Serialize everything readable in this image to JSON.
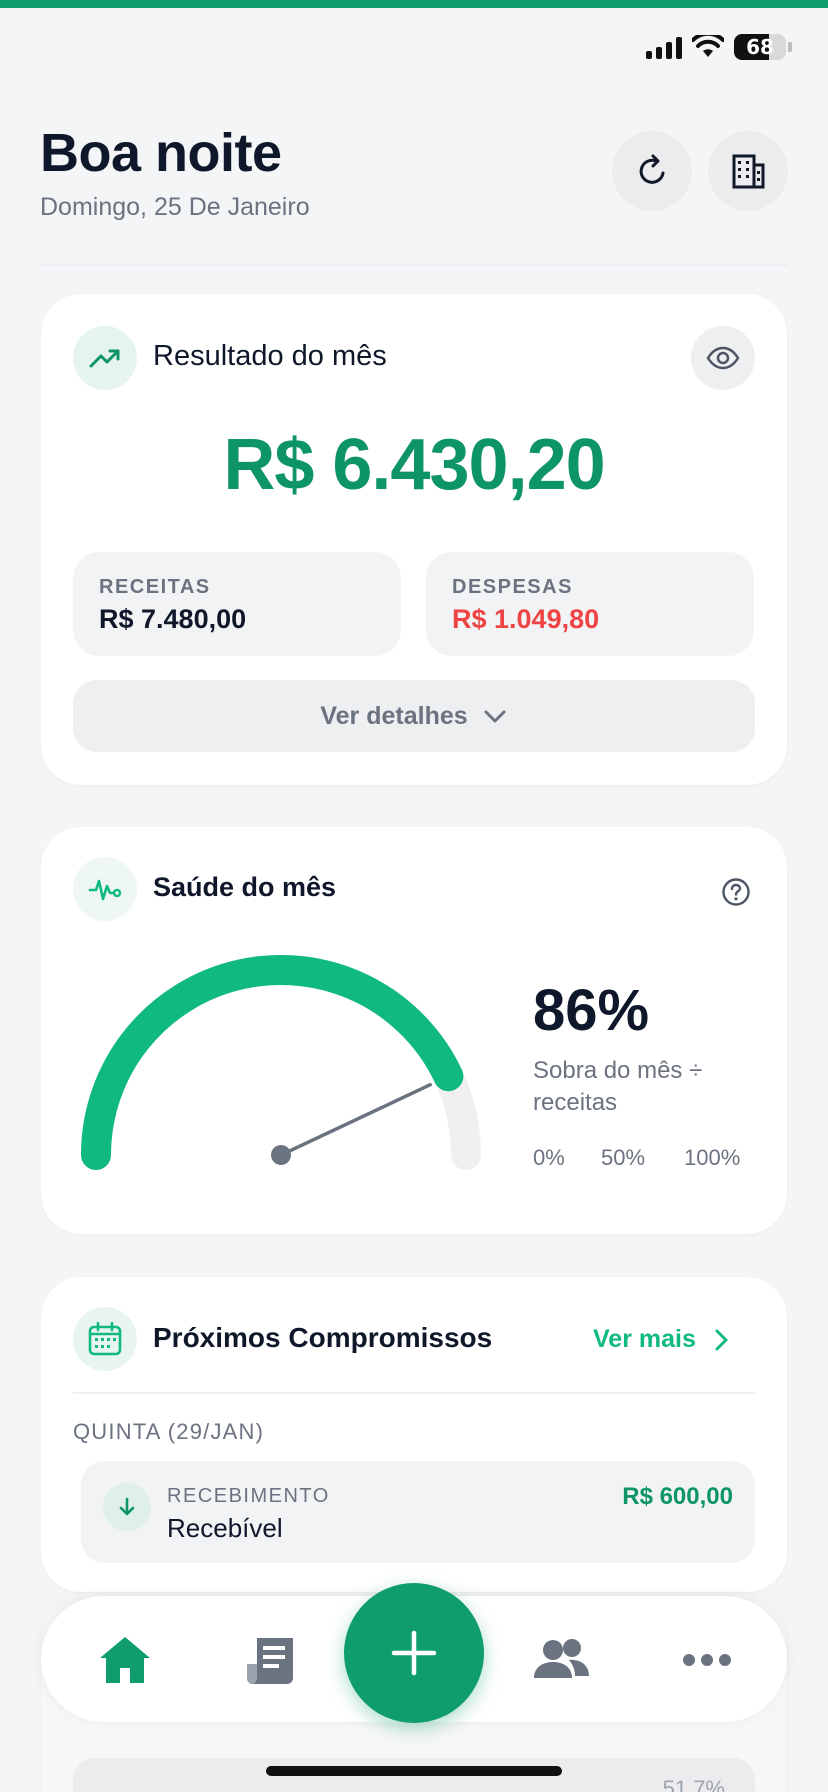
{
  "status_bar": {
    "battery": "68"
  },
  "header": {
    "greeting": "Boa noite",
    "date": "Domingo, 25 De Janeiro",
    "refresh_icon": "refresh-icon",
    "company_icon": "building-icon"
  },
  "result_card": {
    "title": "Resultado do mês",
    "amount": "R$ 6.430,20",
    "income_label": "RECEITAS",
    "income_value": "R$ 7.480,00",
    "expense_label": "DESPESAS",
    "expense_value": "R$ 1.049,80",
    "details_label": "Ver detalhes",
    "accent": "#0d9467",
    "expense_color": "#ef4444"
  },
  "health_card": {
    "title": "Saúde do mês",
    "percent_text": "86%",
    "percent_value": 0.86,
    "description": "Sobra do mês ÷ receitas",
    "scale": [
      "0%",
      "50%",
      "100%"
    ],
    "gauge_color": "#10b981"
  },
  "commitments_card": {
    "title": "Próximos Compromissos",
    "see_more": "Ver mais",
    "day_label": "QUINTA (29/JAN)",
    "items": [
      {
        "type": "RECEBIMENTO",
        "name": "Recebível",
        "amount": "R$ 600,00"
      }
    ]
  },
  "peek": {
    "text": "51,7%"
  },
  "nav": {
    "items": [
      "home-icon",
      "receipt-icon",
      "add-icon",
      "people-icon",
      "more-icon"
    ],
    "active": "home-icon"
  }
}
